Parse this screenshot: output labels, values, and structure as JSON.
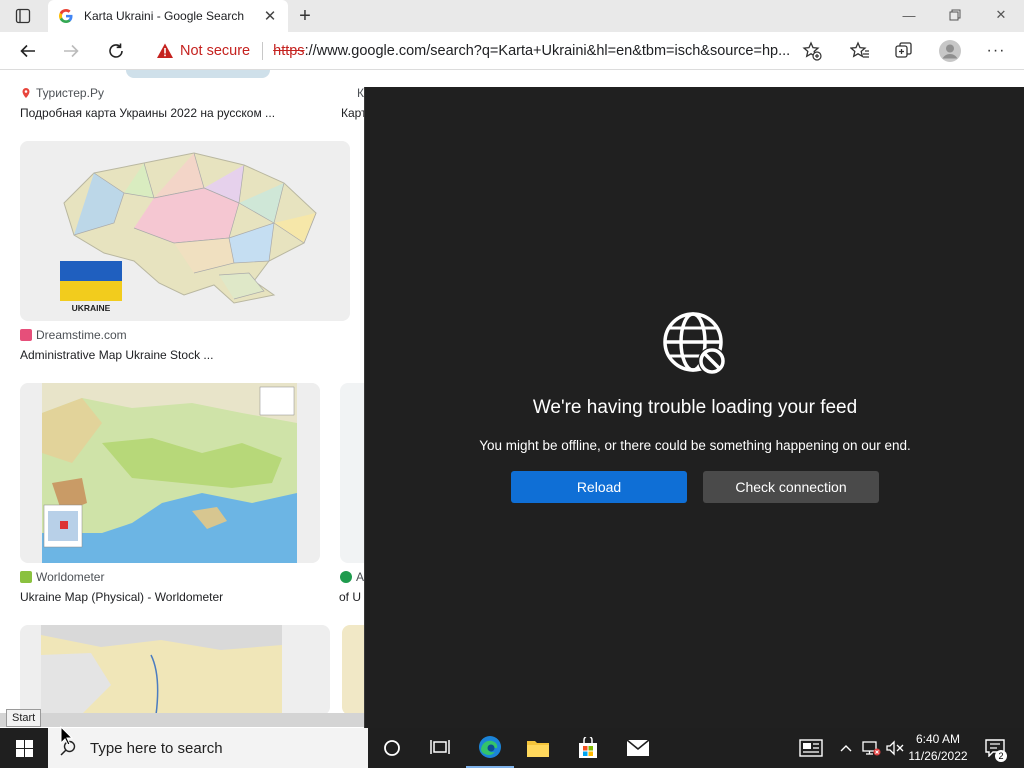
{
  "browser": {
    "tab": {
      "title": "Karta Ukraini - Google Search"
    },
    "address": {
      "security_label": "Not secure",
      "url_scheme": "https",
      "url_rest": "://www.google.com/search?q=Karta+Ukraini&hl=en&tbm=isch&source=hp..."
    }
  },
  "results": {
    "items": [
      {
        "source": "Туристер.Ру",
        "title": "Подробная карта Украины 2022 на русском ..."
      },
      {
        "source": "Dreamstime.com",
        "title": "Administrative Map Ukraine Stock ..."
      },
      {
        "source": "Worldometer",
        "title": "Ukraine Map (Physical) - Worldometer"
      }
    ],
    "partial_right": [
      {
        "source": "К",
        "title": "Карт"
      },
      {
        "source": "A",
        "title": "of U"
      }
    ],
    "flag_label": "UKRAINE"
  },
  "feed": {
    "heading": "We're having trouble loading your feed",
    "message": "You might be offline, or there could be something happening on our end.",
    "reload_label": "Reload",
    "check_label": "Check connection"
  },
  "tooltip": {
    "start": "Start"
  },
  "taskbar": {
    "search_placeholder": "Type here to search",
    "time": "6:40 AM",
    "date": "11/26/2022",
    "notification_count": "2"
  },
  "colors": {
    "feed_bg": "#202020",
    "reload_button": "#0f6fd6",
    "check_button": "#4a4a4a",
    "not_secure": "#c5221f",
    "taskbar": "#1f1f1f"
  }
}
